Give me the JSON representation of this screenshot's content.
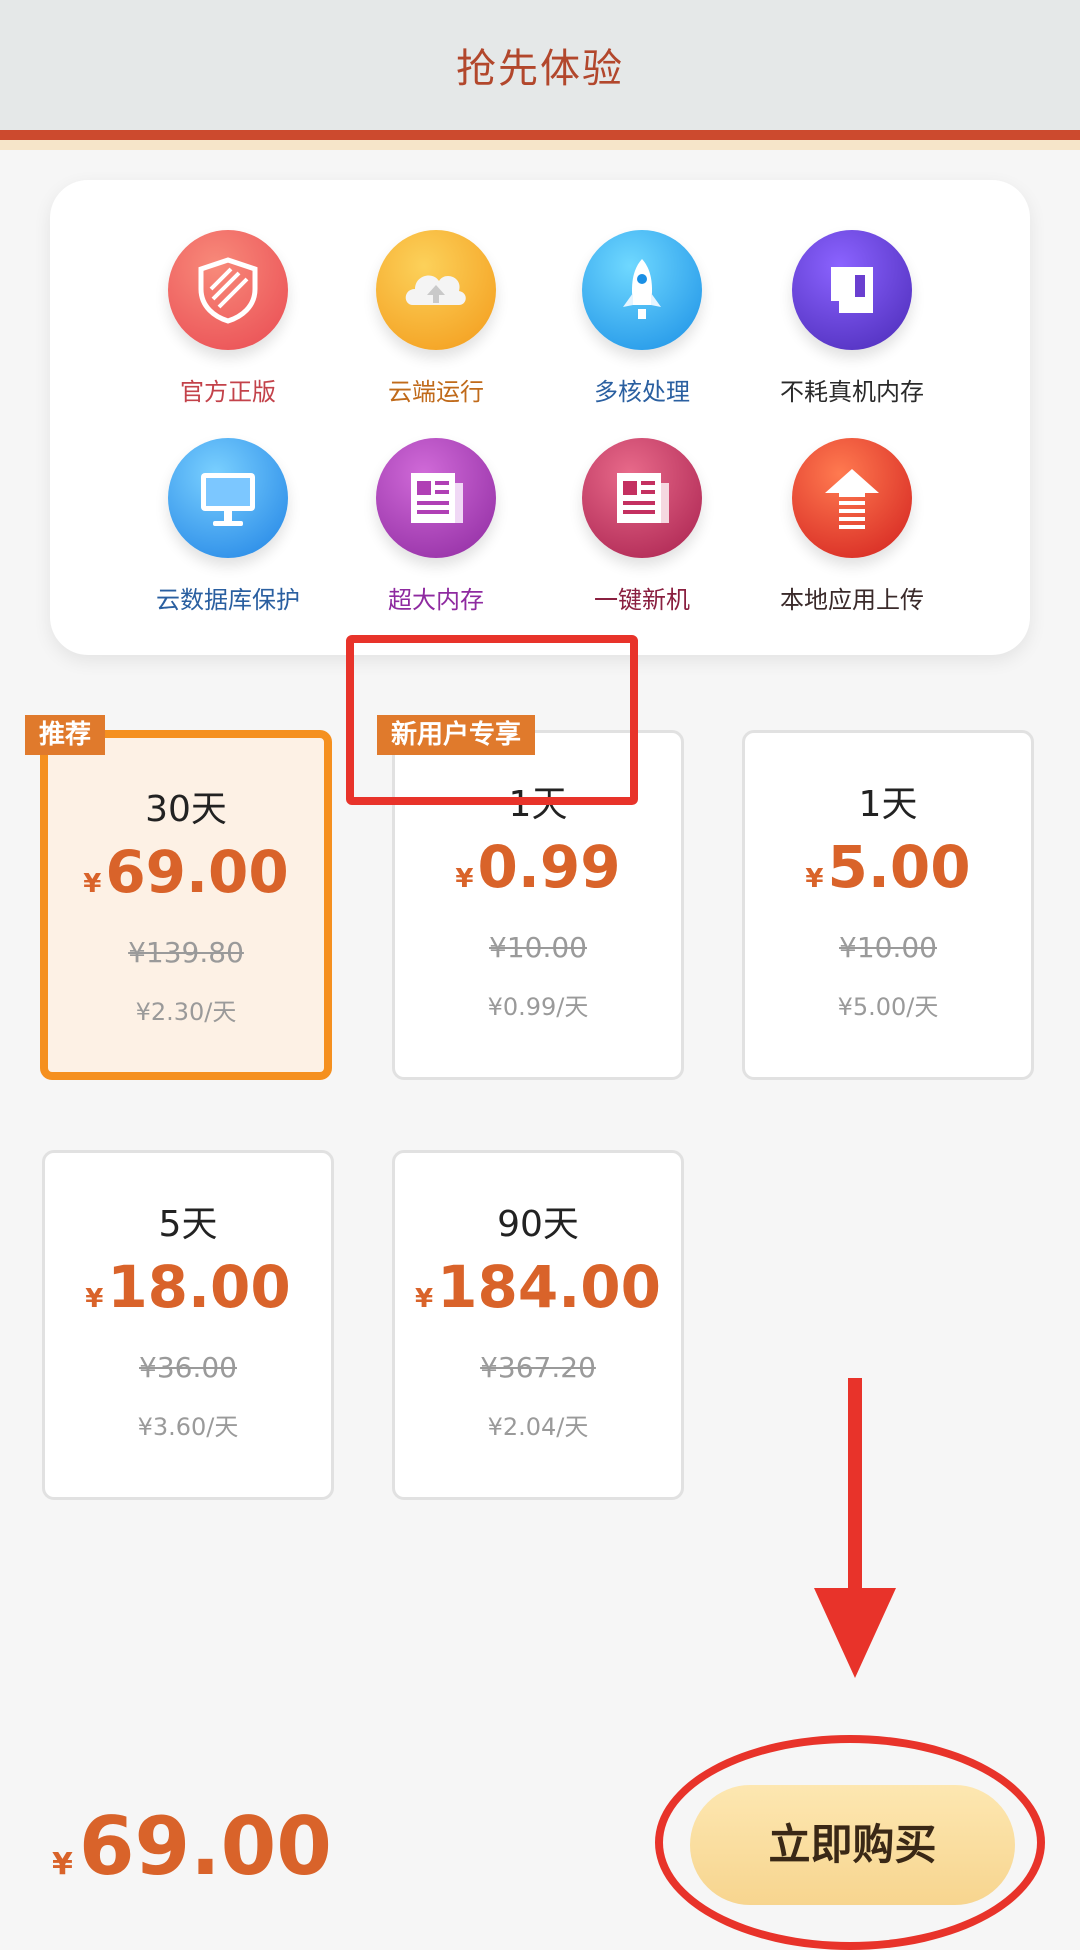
{
  "header": {
    "title": "抢先体验"
  },
  "features": [
    {
      "label": "官方正版",
      "icon": "shield-icon",
      "color": "#f05a5a"
    },
    {
      "label": "云端运行",
      "icon": "cloud-upload-icon",
      "color": "#f7a51f"
    },
    {
      "label": "多核处理",
      "icon": "rocket-icon",
      "color": "#1fa3ee"
    },
    {
      "label": "不耗真机内存",
      "icon": "memory-card-icon",
      "color": "#6a3fd0"
    },
    {
      "label": "云数据库保护",
      "icon": "monitor-icon",
      "color": "#2496ea"
    },
    {
      "label": "超大内存",
      "icon": "newspaper-icon",
      "color": "#b040b5"
    },
    {
      "label": "一键新机",
      "icon": "newspaper-icon",
      "color": "#c43060"
    },
    {
      "label": "本地应用上传",
      "icon": "upload-arrow-icon",
      "color": "#e63a2a"
    }
  ],
  "plans": [
    {
      "duration": "30天",
      "currency": "¥",
      "price": "69.00",
      "original": "¥139.80",
      "daily": "¥2.30/天",
      "selected": true,
      "tag": "推荐"
    },
    {
      "duration": "1天",
      "currency": "¥",
      "price": "0.99",
      "original": "¥10.00",
      "daily": "¥0.99/天",
      "selected": false,
      "tag": "新用户专享"
    },
    {
      "duration": "1天",
      "currency": "¥",
      "price": "5.00",
      "original": "¥10.00",
      "daily": "¥5.00/天",
      "selected": false
    },
    {
      "duration": "5天",
      "currency": "¥",
      "price": "18.00",
      "original": "¥36.00",
      "daily": "¥3.60/天",
      "selected": false
    },
    {
      "duration": "90天",
      "currency": "¥",
      "price": "184.00",
      "original": "¥367.20",
      "daily": "¥2.04/天",
      "selected": false
    }
  ],
  "footer": {
    "currency": "¥",
    "total": "69.00",
    "buy_label": "立即购买"
  },
  "annotations": {
    "color": "#e8332a"
  }
}
